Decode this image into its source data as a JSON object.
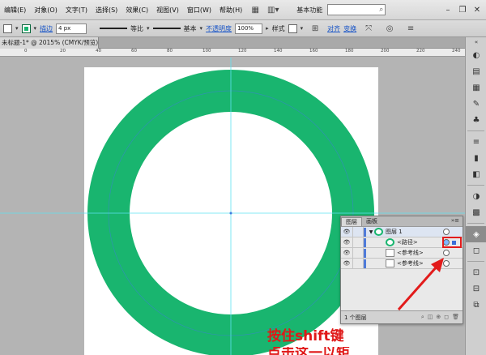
{
  "menu": {
    "items": [
      "编辑(E)",
      "对象(O)",
      "文字(T)",
      "选择(S)",
      "效果(C)",
      "视图(V)",
      "窗口(W)",
      "帮助(H)"
    ],
    "workspace": "基本功能"
  },
  "control": {
    "stroke_link": "描边",
    "stroke_weight": "4 px",
    "profile": "等比",
    "brush": "基本",
    "opacity_link": "不透明度",
    "opacity_value": "100%",
    "style_label": "样式",
    "align_link": "对齐",
    "transform_link": "变换"
  },
  "document": {
    "tab_title": "未标题-1* @ 2015% (CMYK/预览)"
  },
  "ruler": {
    "labels": [
      "0",
      "20",
      "40",
      "60",
      "80",
      "100",
      "120",
      "140",
      "160",
      "180",
      "200",
      "220",
      "240"
    ]
  },
  "artwork": {
    "ring_color": "#19B56F",
    "guide_color": "#5EE1F0"
  },
  "layers_panel": {
    "tab_layers": "图层",
    "tab_artboards": "画板",
    "rows": [
      {
        "label": "图层 1"
      },
      {
        "label": "<路径>"
      },
      {
        "label": "<参考线>"
      },
      {
        "label": "<参考线>"
      }
    ],
    "footer": "1 个图层"
  },
  "annotation": {
    "line1": "按住shift键",
    "line2": "点击这一以矩"
  }
}
